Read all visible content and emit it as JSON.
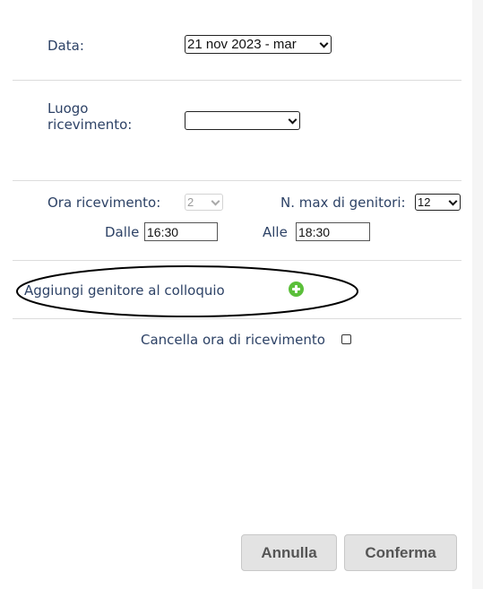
{
  "form": {
    "data_label": "Data:",
    "data_value": "21 nov 2023 - mar",
    "luogo_label": "Luogo ricevimento:",
    "luogo_value": "",
    "ora_label": "Ora ricevimento:",
    "ora_value": "2",
    "max_genitori_label": "N. max di genitori:",
    "max_genitori_value": "12",
    "dalle_label": "Dalle",
    "dalle_value": "16:30",
    "alle_label": "Alle",
    "alle_value": "18:30",
    "aggiungi_label": "Aggiungi genitore al colloquio",
    "cancella_label": "Cancella ora di ricevimento"
  },
  "buttons": {
    "annulla": "Annulla",
    "conferma": "Conferma"
  },
  "icons": {
    "add": "plus-circle-icon",
    "dropdown": "chevron-down-icon"
  },
  "colors": {
    "label_text": "#2d4266",
    "add_icon": "#5bbf3a",
    "button_bg": "#e3e3e3"
  }
}
